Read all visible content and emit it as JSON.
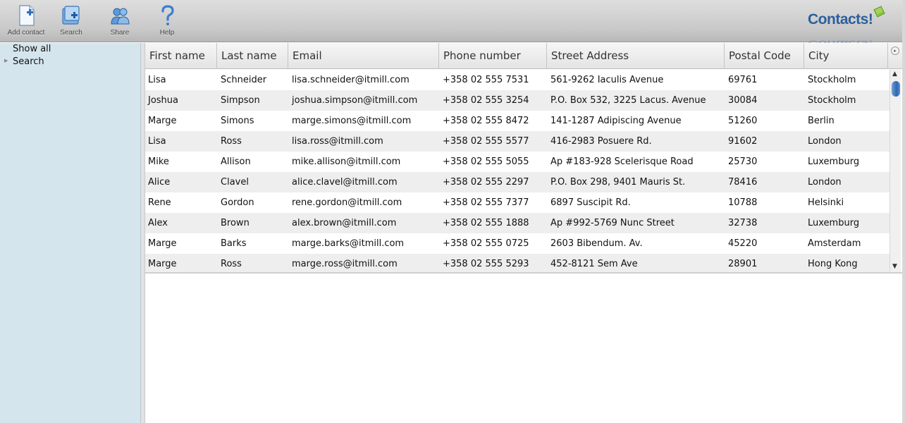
{
  "toolbar": {
    "buttons": [
      {
        "label": "Add contact",
        "icon": "add-contact-icon"
      },
      {
        "label": "Search",
        "icon": "search-icon"
      },
      {
        "label": "Share",
        "icon": "share-icon"
      },
      {
        "label": "Help",
        "icon": "help-icon"
      }
    ]
  },
  "logo": {
    "text": "Contacts!"
  },
  "sidebar": {
    "items": [
      {
        "label": "Show all"
      },
      {
        "label": "Search"
      }
    ]
  },
  "table": {
    "columns": [
      "First name",
      "Last name",
      "Email",
      "Phone number",
      "Street Address",
      "Postal Code",
      "City"
    ],
    "rows": [
      [
        "Lisa",
        "Schneider",
        "lisa.schneider@itmill.com",
        "+358 02 555 7531",
        "561-9262 Iaculis Avenue",
        "69761",
        "Stockholm"
      ],
      [
        "Joshua",
        "Simpson",
        "joshua.simpson@itmill.com",
        "+358 02 555 3254",
        "P.O. Box 532, 3225 Lacus. Avenue",
        "30084",
        "Stockholm"
      ],
      [
        "Marge",
        "Simons",
        "marge.simons@itmill.com",
        "+358 02 555 8472",
        "141-1287 Adipiscing Avenue",
        "51260",
        "Berlin"
      ],
      [
        "Lisa",
        "Ross",
        "lisa.ross@itmill.com",
        "+358 02 555 5577",
        "416-2983 Posuere Rd.",
        "91602",
        "London"
      ],
      [
        "Mike",
        "Allison",
        "mike.allison@itmill.com",
        "+358 02 555 5055",
        "Ap #183-928 Scelerisque Road",
        "25730",
        "Luxemburg"
      ],
      [
        "Alice",
        "Clavel",
        "alice.clavel@itmill.com",
        "+358 02 555 2297",
        "P.O. Box 298, 9401 Mauris St.",
        "78416",
        "London"
      ],
      [
        "Rene",
        "Gordon",
        "rene.gordon@itmill.com",
        "+358 02 555 7377",
        "6897 Suscipit Rd.",
        "10788",
        "Helsinki"
      ],
      [
        "Alex",
        "Brown",
        "alex.brown@itmill.com",
        "+358 02 555 1888",
        "Ap #992-5769 Nunc Street",
        "32738",
        "Luxemburg"
      ],
      [
        "Marge",
        "Barks",
        "marge.barks@itmill.com",
        "+358 02 555 0725",
        "2603 Bibendum. Av.",
        "45220",
        "Amsterdam"
      ],
      [
        "Marge",
        "Ross",
        "marge.ross@itmill.com",
        "+358 02 555 5293",
        "452-8121 Sem Ave",
        "28901",
        "Hong Kong"
      ]
    ]
  },
  "colors": {
    "sidebar_bg": "#d5e5ee",
    "logo_blue": "#2b5f9e",
    "accent_green": "#8cc63f"
  }
}
